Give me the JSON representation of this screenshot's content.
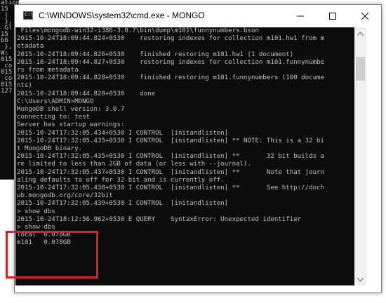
{
  "background_console": {
    "lines": [
      "ation",
      "15",
      " (",
      " },",
      " Gl",
      "15",
      "b6",
      " },",
      "W:",
      "015",
      " co",
      "015",
      " co",
      "015",
      "127"
    ]
  },
  "window": {
    "title": "C:\\WINDOWS\\system32\\cmd.exe - MONGO",
    "minimize_label": "Minimize",
    "maximize_label": "Maximize",
    "close_label": "Close"
  },
  "console": {
    "lines": [
      " Files\\mongodb-win32-i386-3.0.7\\bin\\dump\\m101\\funnynumbers.bson",
      "2015-10-24T18:09:44.824+0530    restoring indexes for collection m101.hw1 from m",
      "etadata",
      "2015-10-24T18:09:44.826+0530    finished restoring m101.hw1 (1 document)",
      "2015-10-24T18:09:44.827+0530    restoring indexes for collection m101.funnynumbe",
      "rs from metadata",
      "2015-10-24T18:09:44.828+0530    finished restoring m101.funnynumbers (100 docume",
      "nts)",
      "2015-10-24T18:09:44.828+0530    done",
      "",
      "C:\\Users\\ADMIN>MONGO",
      "MongoDB shell version: 3.0.7",
      "connecting to: test",
      "Server has startup warnings:",
      "2015-10-24T17:32:05.434+0530 I CONTROL  [initandlisten]",
      "2015-10-24T17:32:05.435+0530 I CONTROL  [initandlisten] ** NOTE: This is a 32 bi",
      "t MongoDB binary.",
      "2015-10-24T17:32:05.435+0530 I CONTROL  [initandlisten] **       32 bit builds a",
      "re limited to less than 2GB of data (or less with --journal).",
      "2015-10-24T17:32:05.437+0530 I CONTROL  [initandlisten] **       Note that journ",
      "aling defaults to off for 32 bit and is currently off.",
      "2015-10-24T17:32:05.438+0530 I CONTROL  [initandlisten] **       See http://doch",
      "ub.mongodb.org/core/32bit",
      "2015-10-24T17:32:05.439+0530 I CONTROL  [initandlisten]",
      "> show dbs",
      "2015-10-24T18:12:56.962+0530 E QUERY    SyntaxError: Unexpected identifier",
      "> show dbs",
      "local  0.078GB",
      "m101   0.078GB"
    ]
  },
  "colors": {
    "console_bg": "#0c0c0c",
    "console_text": "#c0c0c0",
    "highlight": "#e02020"
  }
}
